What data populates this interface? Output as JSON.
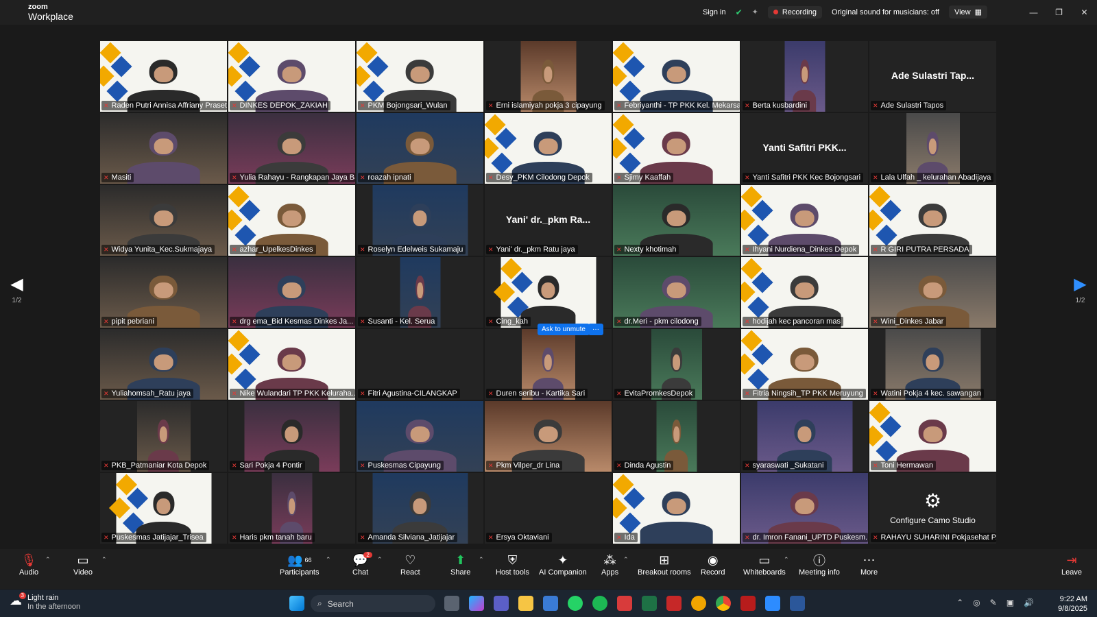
{
  "titlebar": {
    "brand_top": "zoom",
    "brand_bottom": "Workplace",
    "sign_in": "Sign in",
    "recording": "Recording",
    "original_sound": "Original sound for musicians: off",
    "view": "View"
  },
  "gallery": {
    "page_indicator_left": "1/2",
    "page_indicator_right": "1/2",
    "ask_unmute": "Ask to unmute",
    "more": "···",
    "tiles": [
      {
        "name": "Raden Putri Annisa Affriany Prasetyo",
        "big": ""
      },
      {
        "name": "DINKES DEPOK_ZAKIAH",
        "big": ""
      },
      {
        "name": "PKM Bojongsari_Wulan",
        "big": ""
      },
      {
        "name": "Erni islamiyah pokja 3 cipayung",
        "big": ""
      },
      {
        "name": "Febriyanthi - TP PKK Kel. Mekarsari",
        "big": ""
      },
      {
        "name": "Berta kusbardini",
        "big": ""
      },
      {
        "name": "Ade Sulastri Tapos",
        "big": "Ade Sulastri Tap..."
      },
      {
        "name": "Masiti",
        "big": ""
      },
      {
        "name": "Yulia Rahayu - Rangkapan Jaya Baru",
        "big": ""
      },
      {
        "name": "roazah ipnati",
        "big": ""
      },
      {
        "name": "Desy_PKM Cilodong Depok",
        "big": ""
      },
      {
        "name": "Sjimy Kaaffah",
        "big": ""
      },
      {
        "name": "Yanti Safitri PKK Kec Bojongsari",
        "big": "Yanti Safitri PKK..."
      },
      {
        "name": "Lala Ulfah _ kelurahan Abadijaya",
        "big": ""
      },
      {
        "name": "Widya Yunita_Kec.Sukmajaya",
        "big": ""
      },
      {
        "name": "azhar_UpelkesDinkes",
        "big": ""
      },
      {
        "name": "Roselyn Edelweis Sukamaju",
        "big": ""
      },
      {
        "name": "Yani' dr._pkm Ratu jaya",
        "big": "Yani' dr._pkm Ra..."
      },
      {
        "name": "Nexty khotimah",
        "big": ""
      },
      {
        "name": "Ihyani Nurdiena_Dinkes Depok",
        "big": ""
      },
      {
        "name": "R GIRI PUTRA PERSADA",
        "big": ""
      },
      {
        "name": "pipit pebriani",
        "big": ""
      },
      {
        "name": "drg ema_Bid Kesmas Dinkes Ja...",
        "big": ""
      },
      {
        "name": "Susanti - Kel. Serua",
        "big": ""
      },
      {
        "name": "Cing_kah",
        "big": ""
      },
      {
        "name": "dr.Meri - pkm cilodong",
        "big": ""
      },
      {
        "name": "hodijah kec pancoran mas",
        "big": ""
      },
      {
        "name": "Wini_Dinkes Jabar",
        "big": ""
      },
      {
        "name": "Yuliahomsah_Ratu jaya",
        "big": ""
      },
      {
        "name": "Nike Wulandari TP PKK Keluraha...",
        "big": ""
      },
      {
        "name": "Fitri Agustina-CILANGKAP",
        "big": ""
      },
      {
        "name": "Duren seribu - Kartika Sari",
        "big": ""
      },
      {
        "name": "EvitaPromkesDepok",
        "big": ""
      },
      {
        "name": "Fitria Ningsih_TP PKK Meruyung",
        "big": ""
      },
      {
        "name": "Watini Pokja 4 kec. sawangan",
        "big": ""
      },
      {
        "name": "PKB_Patmaniar Kota Depok",
        "big": ""
      },
      {
        "name": "Sari Pokja 4 Pontir",
        "big": ""
      },
      {
        "name": "Puskesmas Cipayung",
        "big": ""
      },
      {
        "name": "Pkm Vilper_dr Lina",
        "big": ""
      },
      {
        "name": "Dinda Agustin",
        "big": ""
      },
      {
        "name": "syaraswati _Sukatani",
        "big": ""
      },
      {
        "name": "Toni Hermawan",
        "big": ""
      },
      {
        "name": "Puskesmas Jatijajar_Trisea",
        "big": ""
      },
      {
        "name": "Haris pkm tanah baru",
        "big": ""
      },
      {
        "name": "Amanda Silviana_Jatijajar",
        "big": ""
      },
      {
        "name": "Ersya Oktaviani",
        "big": ""
      },
      {
        "name": "Ida",
        "big": ""
      },
      {
        "name": "dr. Imron Fanani_UPTD Puskesm...",
        "big": ""
      },
      {
        "name": "RAHAYU SUHARINI Pokjasehat P...",
        "big": "Configure Camo Studio"
      }
    ]
  },
  "toolbar": {
    "audio": "Audio",
    "video": "Video",
    "participants": "Participants",
    "participants_count": "66",
    "chat": "Chat",
    "chat_badge": "2",
    "react": "React",
    "share": "Share",
    "host_tools": "Host tools",
    "ai_companion": "AI Companion",
    "apps": "Apps",
    "breakout": "Breakout rooms",
    "record": "Record",
    "whiteboards": "Whiteboards",
    "meeting_info": "Meeting info",
    "more": "More",
    "leave": "Leave"
  },
  "taskbar": {
    "weather_title": "Light rain",
    "weather_sub": "In the afternoon",
    "weather_badge": "3",
    "search": "Search",
    "time": "9:22 AM",
    "date": "9/8/2025"
  }
}
